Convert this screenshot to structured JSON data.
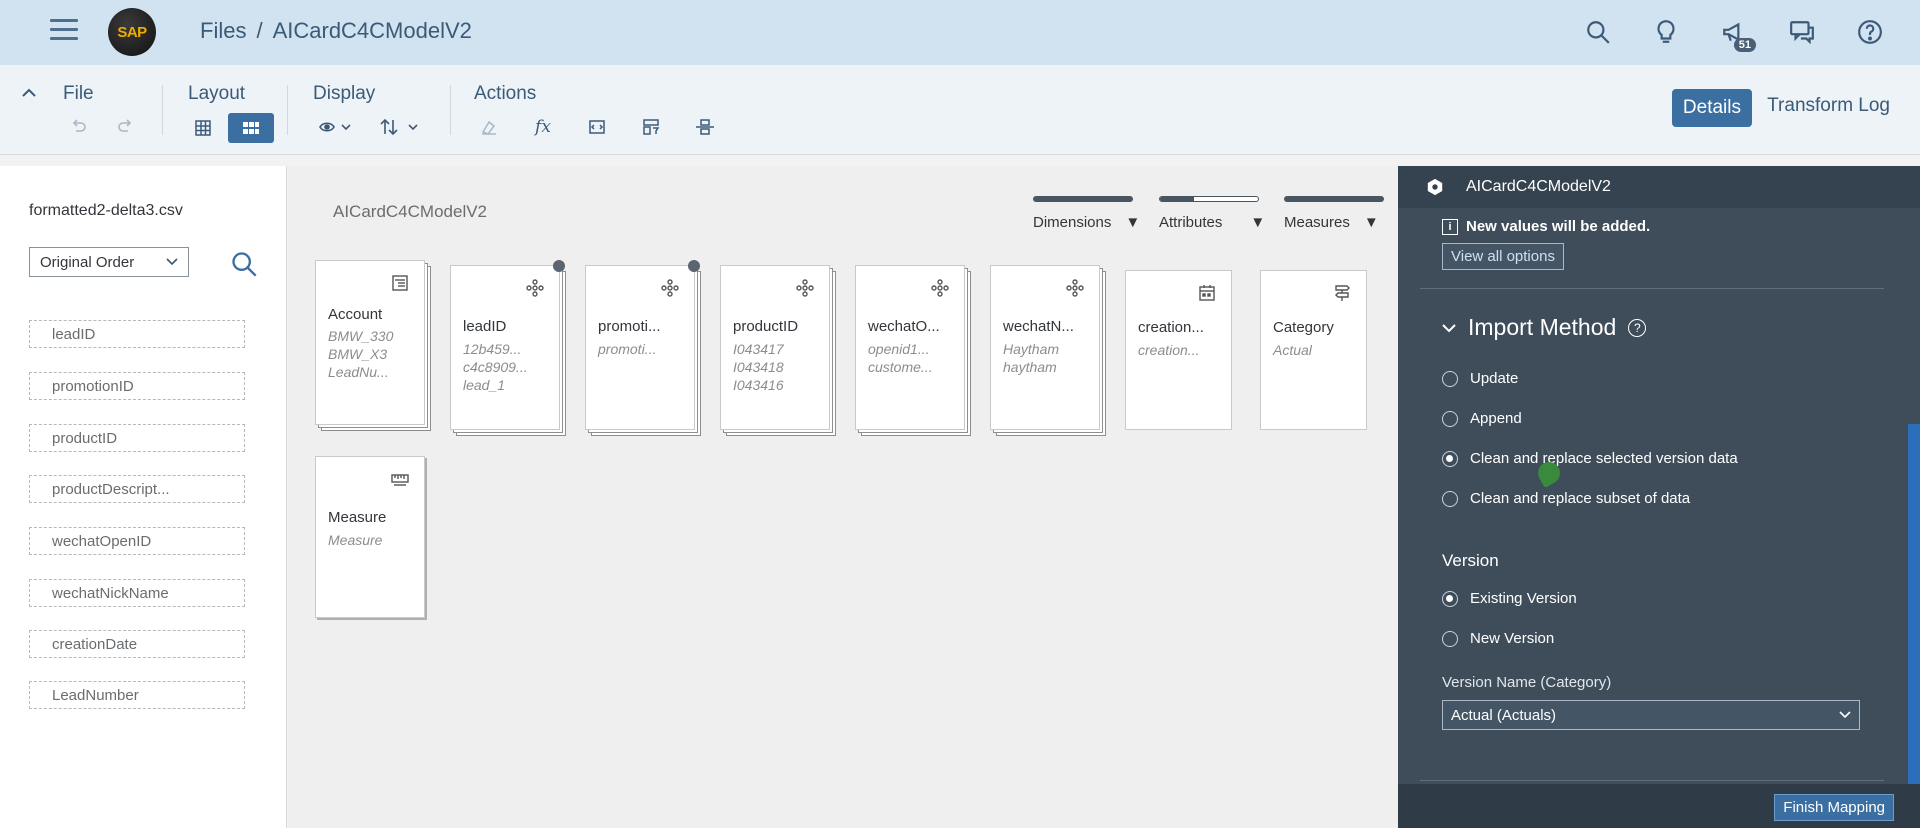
{
  "shell": {
    "logo_text": "SAP",
    "breadcrumb": [
      "Files",
      "AICardC4CModelV2"
    ],
    "notification_count": "51",
    "icons": [
      "search-icon",
      "lightbulb-icon",
      "megaphone-icon",
      "feedback-icon",
      "help-icon"
    ]
  },
  "toolbar": {
    "groups": {
      "file": "File",
      "layout": "Layout",
      "display": "Display",
      "actions": "Actions"
    },
    "details": "Details",
    "transform_log": "Transform Log"
  },
  "left": {
    "filename": "formatted2-delta3.csv",
    "order": "Original Order",
    "fields": [
      "leadID",
      "promotionID",
      "productID",
      "productDescript...",
      "wechatOpenID",
      "wechatNickName",
      "creationDate",
      "LeadNumber"
    ]
  },
  "canvas": {
    "model_name": "AICardC4CModelV2",
    "legend": [
      "Dimensions",
      "Attributes",
      "Measures"
    ],
    "cards": [
      {
        "title": "Account",
        "values": [
          "BMW_330",
          "BMW_X3",
          "LeadNu..."
        ],
        "icon": "hierarchy-icon"
      },
      {
        "title": "leadID",
        "values": [
          "12b459...",
          "c4c8909...",
          "lead_1"
        ],
        "icon": "dimension-icon"
      },
      {
        "title": "promoti...",
        "values": [
          "promoti..."
        ],
        "icon": "dimension-icon"
      },
      {
        "title": "productID",
        "values": [
          "I043417",
          "I043418",
          "I043416"
        ],
        "icon": "dimension-icon"
      },
      {
        "title": "wechatO...",
        "values": [
          "openid1...",
          "custome..."
        ],
        "icon": "dimension-icon"
      },
      {
        "title": "wechatN...",
        "values": [
          "Haytham",
          "haytham"
        ],
        "icon": "dimension-icon"
      },
      {
        "title": "creation...",
        "values": [
          "creation..."
        ],
        "icon": "calendar-icon"
      },
      {
        "title": "Category",
        "values": [
          "Actual"
        ],
        "icon": "version-icon"
      },
      {
        "title": "Measure",
        "values": [
          "Measure"
        ],
        "icon": "measure-icon"
      }
    ]
  },
  "details": {
    "title": "AICardC4CModelV2",
    "info": "New values will be added.",
    "view_all": "View all options",
    "import_method": "Import Method",
    "methods": [
      "Update",
      "Append",
      "Clean and replace selected version data",
      "Clean and replace subset of data"
    ],
    "method_selected": "Clean and replace selected version data",
    "version_title": "Version",
    "versions": [
      "Existing Version",
      "New Version"
    ],
    "version_selected": "Existing Version",
    "version_name_label": "Version Name (Category)",
    "version_name_value": "Actual (Actuals)",
    "finish": "Finish Mapping",
    "colors": {
      "panel": "#3f4d5a",
      "accent": "#3b6ea1",
      "scroll": "#2b6fba"
    }
  }
}
